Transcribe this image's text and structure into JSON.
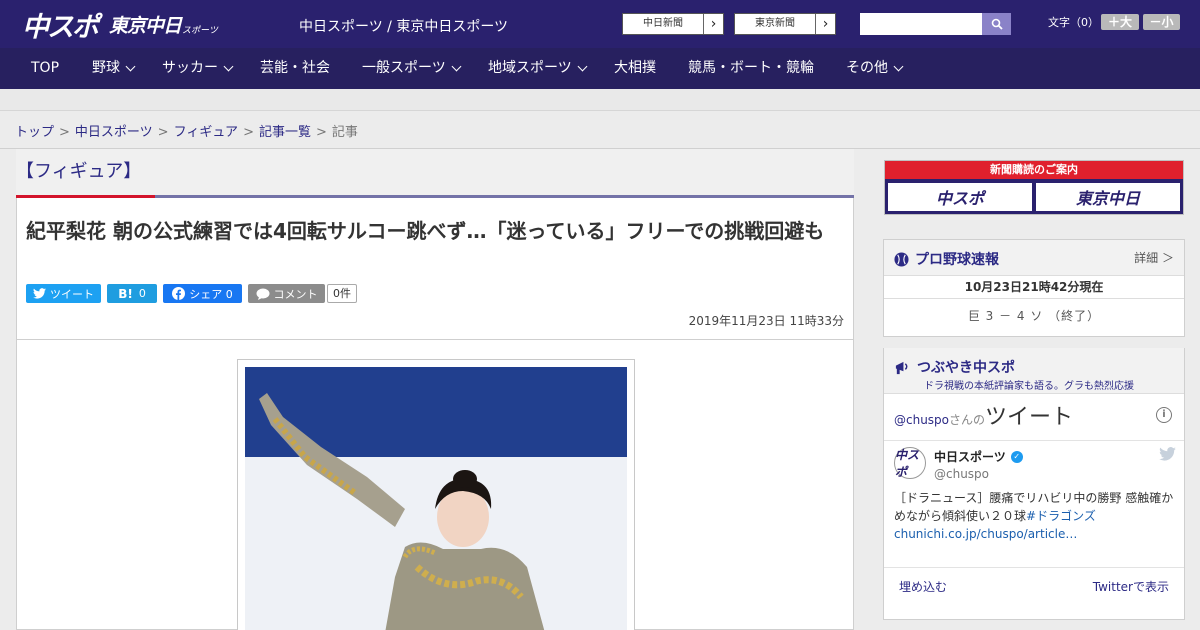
{
  "header": {
    "logo_main": "中スポ",
    "logo_tokyo": "東京中日",
    "logo_tokyo_sub": "スポーツ",
    "site_title": "中日スポーツ / 東京中日スポーツ",
    "paper_links": [
      {
        "label": "中日新聞"
      },
      {
        "label": "東京新聞"
      }
    ],
    "search": {
      "value": "",
      "placeholder": ""
    },
    "font_size": {
      "label": "文字（0）",
      "bigger": "＋大",
      "smaller": "－小"
    }
  },
  "nav": {
    "items": [
      {
        "label": "TOP",
        "dropdown": false
      },
      {
        "label": "野球",
        "dropdown": true
      },
      {
        "label": "サッカー",
        "dropdown": true
      },
      {
        "label": "芸能・社会",
        "dropdown": false
      },
      {
        "label": "一般スポーツ",
        "dropdown": true
      },
      {
        "label": "地域スポーツ",
        "dropdown": true
      },
      {
        "label": "大相撲",
        "dropdown": false
      },
      {
        "label": "競馬・ボート・競輪",
        "dropdown": false
      },
      {
        "label": "その他",
        "dropdown": true
      }
    ]
  },
  "breadcrumb": [
    {
      "label": "トップ",
      "link": true
    },
    {
      "label": "中日スポーツ",
      "link": true
    },
    {
      "label": "フィギュア",
      "link": true
    },
    {
      "label": "記事一覧",
      "link": true
    },
    {
      "label": "記事",
      "link": false
    }
  ],
  "article": {
    "category": "【フィギュア】",
    "headline": "紀平梨花 朝の公式練習では4回転サルコー跳べず…「迷っている」フリーでの挑戦回避も",
    "share": {
      "tweet_label": "ツイート",
      "hatena_count": "0",
      "facebook_label": "シェア 0",
      "comment_label": "コメント",
      "comment_count": "0件"
    },
    "date": "2019年11月23日 11時33分"
  },
  "sidebar": {
    "subscription": {
      "title": "新聞購読のご案内",
      "logo_left": "中スポ",
      "logo_right": "東京中日"
    },
    "baseball": {
      "title": "プロ野球速報",
      "more": "詳細 ＞",
      "time": "10月23日21時42分現在",
      "score": "巨 3 － 4 ソ （終了）"
    },
    "tweets": {
      "title": "つぶやき中スポ",
      "subtitle": "ドラ視戦の本紙評論家も語る。グラも熱烈応援",
      "handle": "@chuspo",
      "san": "さんの",
      "tweet_word": "ツイート",
      "account_name": "中日スポーツ",
      "account_handle": "@chuspo",
      "avatar_text": "中スポ",
      "text": "［ドラニュース］腰痛でリハビリ中の勝野 感触確かめながら傾斜使い２０球",
      "hashtag": "#ドラゴンズ",
      "link": "chunichi.co.jp/chuspo/article…",
      "embed": "埋め込む",
      "view_on_twitter": "Twitterで表示"
    }
  },
  "colors": {
    "header_bg": "#2a216e",
    "nav_bg": "#27205f",
    "accent_red": "#d3142b",
    "link": "#2c2a85"
  }
}
